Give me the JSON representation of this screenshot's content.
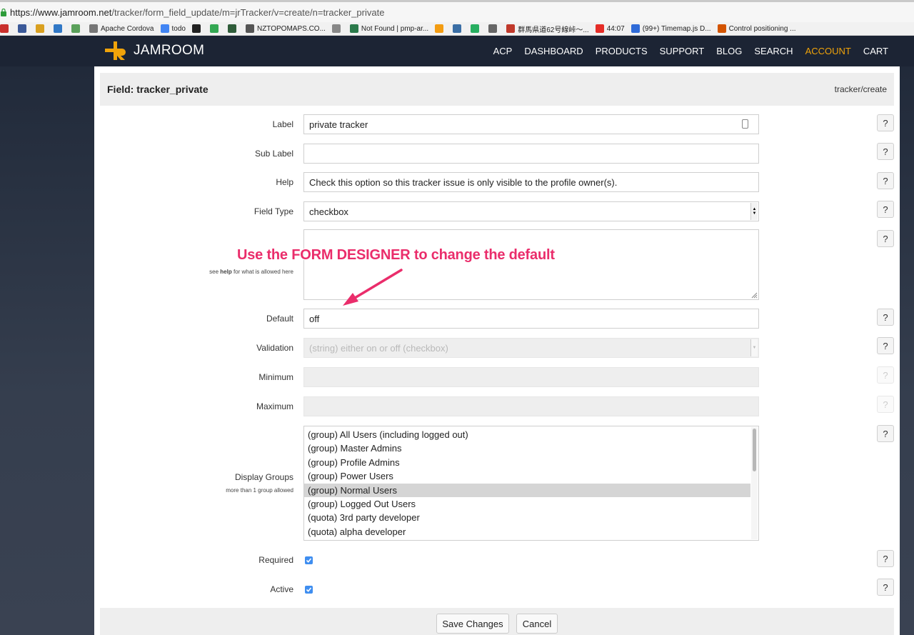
{
  "browser": {
    "url_host": "https://www.jamroom.net",
    "url_path": "/tracker/form_field_update/m=jrTracker/v=create/n=tracker_private",
    "bookmarks": [
      {
        "label": "",
        "color": "#c9302c"
      },
      {
        "label": "",
        "color": "#3b5998"
      },
      {
        "label": "",
        "color": "#d9a020"
      },
      {
        "label": "",
        "color": "#3178c6"
      },
      {
        "label": "",
        "color": "#5aa05a"
      },
      {
        "label": "Apache Cordova",
        "color": "#777777"
      },
      {
        "label": "todo",
        "color": "#4285f4"
      },
      {
        "label": "",
        "color": "#222222"
      },
      {
        "label": "",
        "color": "#34a853"
      },
      {
        "label": "",
        "color": "#2f5d3a"
      },
      {
        "label": "NZTOPOMAPS.CO...",
        "color": "#555555"
      },
      {
        "label": "",
        "color": "#888888"
      },
      {
        "label": "Not Found | pmp-ar...",
        "color": "#2b7a4b"
      },
      {
        "label": "",
        "color": "#f39c12"
      },
      {
        "label": "",
        "color": "#3a6ea5"
      },
      {
        "label": "",
        "color": "#27ae60"
      },
      {
        "label": "",
        "color": "#666666"
      },
      {
        "label": "群馬県道62号線峠〜...",
        "color": "#c0392b"
      },
      {
        "label": "44:07",
        "color": "#e52d27"
      },
      {
        "label": "(99+) Timemap.js D...",
        "color": "#2f6bd8"
      },
      {
        "label": "Control positioning ...",
        "color": "#d35400"
      }
    ]
  },
  "nav": {
    "logo_text": "JAMROOM",
    "items": [
      {
        "label": "ACP",
        "active": false
      },
      {
        "label": "DASHBOARD",
        "active": false
      },
      {
        "label": "PRODUCTS",
        "active": false
      },
      {
        "label": "SUPPORT",
        "active": false
      },
      {
        "label": "BLOG",
        "active": false
      },
      {
        "label": "SEARCH",
        "active": false
      },
      {
        "label": "ACCOUNT",
        "active": true
      },
      {
        "label": "CART",
        "active": false
      }
    ],
    "active_color": "#f0a30a"
  },
  "header": {
    "title": "Field: tracker_private",
    "crumb": "tracker/create"
  },
  "form": {
    "label_label": "Label",
    "label_value": "private tracker",
    "sublabel_label": "Sub Label",
    "sublabel_value": "",
    "help_label": "Help",
    "help_value": "Check this option so this tracker issue is only visible to the profile owner(s).",
    "fieldtype_label": "Field Type",
    "fieldtype_value": "checkbox",
    "options_sub_prefix": "see",
    "options_sub_bold": "help",
    "options_sub_suffix": "for what is allowed here",
    "default_label": "Default",
    "default_value": "off",
    "validation_label": "Validation",
    "validation_value": "(string) either on or off (checkbox)",
    "minimum_label": "Minimum",
    "maximum_label": "Maximum",
    "groups_label": "Display Groups",
    "groups_sub": "more than 1 group allowed",
    "groups": [
      {
        "label": "(group) All Users (including logged out)",
        "selected": false
      },
      {
        "label": "(group) Master Admins",
        "selected": false
      },
      {
        "label": "(group) Profile Admins",
        "selected": false
      },
      {
        "label": "(group) Power Users",
        "selected": false
      },
      {
        "label": "(group) Normal Users",
        "selected": true
      },
      {
        "label": "(group) Logged Out Users",
        "selected": false
      },
      {
        "label": "(quota) 3rd party developer",
        "selected": false
      },
      {
        "label": "(quota) alpha developer",
        "selected": false
      }
    ],
    "required_label": "Required",
    "required_checked": true,
    "active_label": "Active",
    "active_checked": true,
    "help_button": "?"
  },
  "buttons": {
    "save": "Save Changes",
    "cancel": "Cancel"
  },
  "annotation": {
    "text": "Use the FORM DESIGNER to change the default",
    "color": "#ea2d6b"
  }
}
